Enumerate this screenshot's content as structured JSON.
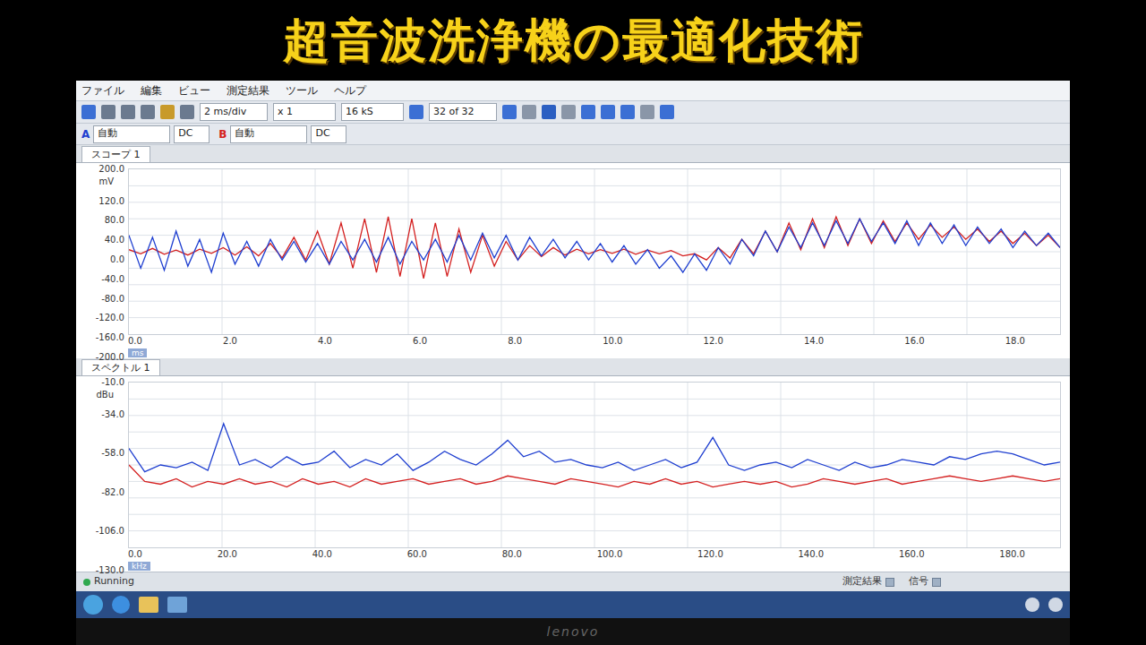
{
  "overlay_title": "超音波洗浄機の最適化技術",
  "menu": [
    "ファイル",
    "編集",
    "ビュー",
    "測定結果",
    "ツール",
    "ヘルプ"
  ],
  "toolbar": {
    "timebase": "2 ms/div",
    "zoom": "x 1",
    "samples": "16 kS",
    "buffer": "32 of 32"
  },
  "channels": [
    {
      "label": "A",
      "mode": "自動",
      "coupling": "DC",
      "color": "#1f3fd0"
    },
    {
      "label": "B",
      "mode": "自動",
      "coupling": "DC",
      "color": "#d42020"
    }
  ],
  "scope": {
    "tab": "スコープ 1",
    "y_unit": "mV",
    "y_max": "200.0",
    "y_ticks": [
      "120.0",
      "80.0",
      "40.0",
      "0.0",
      "-40.0",
      "-80.0",
      "-120.0",
      "-160.0",
      "-200.0"
    ],
    "x_unit": "ms",
    "x_ticks": [
      "0.0",
      "2.0",
      "4.0",
      "6.0",
      "8.0",
      "10.0",
      "12.0",
      "14.0",
      "16.0",
      "18.0"
    ],
    "series": [
      {
        "name": "B",
        "color": "#d42020",
        "values": [
          5,
          -5,
          8,
          -6,
          4,
          -8,
          6,
          -4,
          10,
          -8,
          12,
          -10,
          20,
          -15,
          35,
          -20,
          50,
          -30,
          70,
          -40,
          80,
          -50,
          85,
          -60,
          80,
          -65,
          70,
          -60,
          55,
          -50,
          40,
          -35,
          25,
          -20,
          15,
          -12,
          10,
          -8,
          6,
          -5,
          5,
          -4,
          6,
          -6,
          4,
          -5,
          3,
          -10,
          -5,
          -20,
          10,
          -15,
          30,
          -5,
          50,
          0,
          70,
          5,
          80,
          10,
          85,
          15,
          80,
          20,
          75,
          25,
          70,
          30,
          65,
          35,
          60,
          30,
          55,
          25,
          50,
          20,
          45,
          15,
          40,
          10
        ]
      },
      {
        "name": "A",
        "color": "#1f3fd0",
        "values": [
          40,
          -40,
          35,
          -45,
          50,
          -35,
          30,
          -50,
          45,
          -30,
          25,
          -35,
          30,
          -20,
          25,
          -25,
          20,
          -30,
          25,
          -20,
          30,
          -25,
          35,
          -30,
          25,
          -20,
          30,
          -25,
          40,
          -20,
          45,
          -15,
          40,
          -20,
          35,
          -10,
          30,
          -15,
          25,
          -20,
          20,
          -25,
          15,
          -30,
          5,
          -40,
          -10,
          -50,
          -5,
          -45,
          10,
          -30,
          30,
          -10,
          50,
          0,
          60,
          10,
          70,
          15,
          75,
          20,
          80,
          25,
          70,
          20,
          75,
          15,
          70,
          20,
          65,
          15,
          60,
          20,
          55,
          10,
          50,
          15,
          45,
          10
        ]
      }
    ]
  },
  "spectrum": {
    "tab": "スペクトル 1",
    "y_unit": "dBu",
    "y_max": "-10.0",
    "y_ticks": [
      "-34.0",
      "-58.0",
      "-82.0",
      "-106.0",
      "-130.0"
    ],
    "x_unit": "kHz",
    "x_ticks": [
      "0.0",
      "20.0",
      "40.0",
      "60.0",
      "80.0",
      "100.0",
      "120.0",
      "140.0",
      "160.0",
      "180.0"
    ],
    "series": [
      {
        "name": "B",
        "color": "#d42020",
        "values": [
          -70,
          -82,
          -84,
          -80,
          -86,
          -82,
          -84,
          -80,
          -84,
          -82,
          -86,
          -80,
          -84,
          -82,
          -86,
          -80,
          -84,
          -82,
          -80,
          -84,
          -82,
          -80,
          -84,
          -82,
          -78,
          -80,
          -82,
          -84,
          -80,
          -82,
          -84,
          -86,
          -82,
          -84,
          -80,
          -84,
          -82,
          -86,
          -84,
          -82,
          -84,
          -82,
          -86,
          -84,
          -80,
          -82,
          -84,
          -82,
          -80,
          -84,
          -82,
          -80,
          -78,
          -80,
          -82,
          -80,
          -78,
          -80,
          -82,
          -80
        ]
      },
      {
        "name": "A",
        "color": "#1f3fd0",
        "values": [
          -58,
          -75,
          -70,
          -72,
          -68,
          -74,
          -40,
          -70,
          -66,
          -72,
          -64,
          -70,
          -68,
          -60,
          -72,
          -66,
          -70,
          -62,
          -74,
          -68,
          -60,
          -66,
          -70,
          -62,
          -52,
          -64,
          -60,
          -68,
          -66,
          -70,
          -72,
          -68,
          -74,
          -70,
          -66,
          -72,
          -68,
          -50,
          -70,
          -74,
          -70,
          -68,
          -72,
          -66,
          -70,
          -74,
          -68,
          -72,
          -70,
          -66,
          -68,
          -70,
          -64,
          -66,
          -62,
          -60,
          -62,
          -66,
          -70,
          -68
        ]
      }
    ]
  },
  "status_bar": {
    "state": "Running",
    "items": [
      "測定結果",
      "信号"
    ]
  },
  "bezel_brand": "lenovo"
}
